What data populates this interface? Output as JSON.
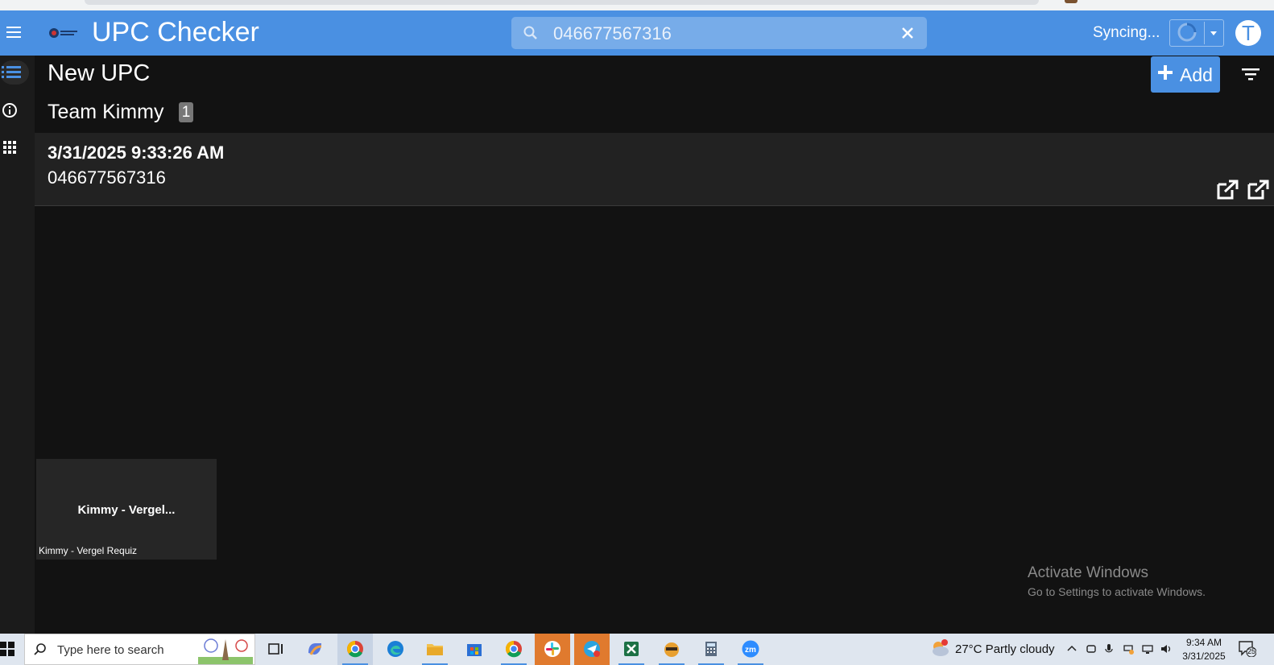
{
  "app": {
    "title": "UPC Checker"
  },
  "search": {
    "value": "046677567316"
  },
  "sync": {
    "label": "Syncing..."
  },
  "user": {
    "initial": "T"
  },
  "toolbar": {
    "title": "New UPC",
    "add_label": "Add"
  },
  "group": {
    "title": "Team Kimmy",
    "count": "1"
  },
  "record": {
    "timestamp": "3/31/2025 9:33:26 AM",
    "upc": "046677567316"
  },
  "video": {
    "name": "Kimmy - Vergel...",
    "caption": "Kimmy - Vergel Requiz"
  },
  "watermark": {
    "title": "Activate Windows",
    "subtitle": "Go to Settings to activate Windows."
  },
  "taskbar": {
    "search_placeholder": "Type here to search",
    "weather": "27°C  Partly cloudy",
    "time": "9:34 AM",
    "date": "3/31/2025",
    "notifications": "25",
    "apps": [
      "task-view",
      "copilot",
      "chrome",
      "edge",
      "file-explorer",
      "microsoft-store",
      "chrome-profile",
      "slack",
      "telegram",
      "excel",
      "game",
      "calculator",
      "zoom"
    ]
  },
  "colors": {
    "accent": "#4a90e2",
    "background": "#121212",
    "record": "#222222"
  }
}
